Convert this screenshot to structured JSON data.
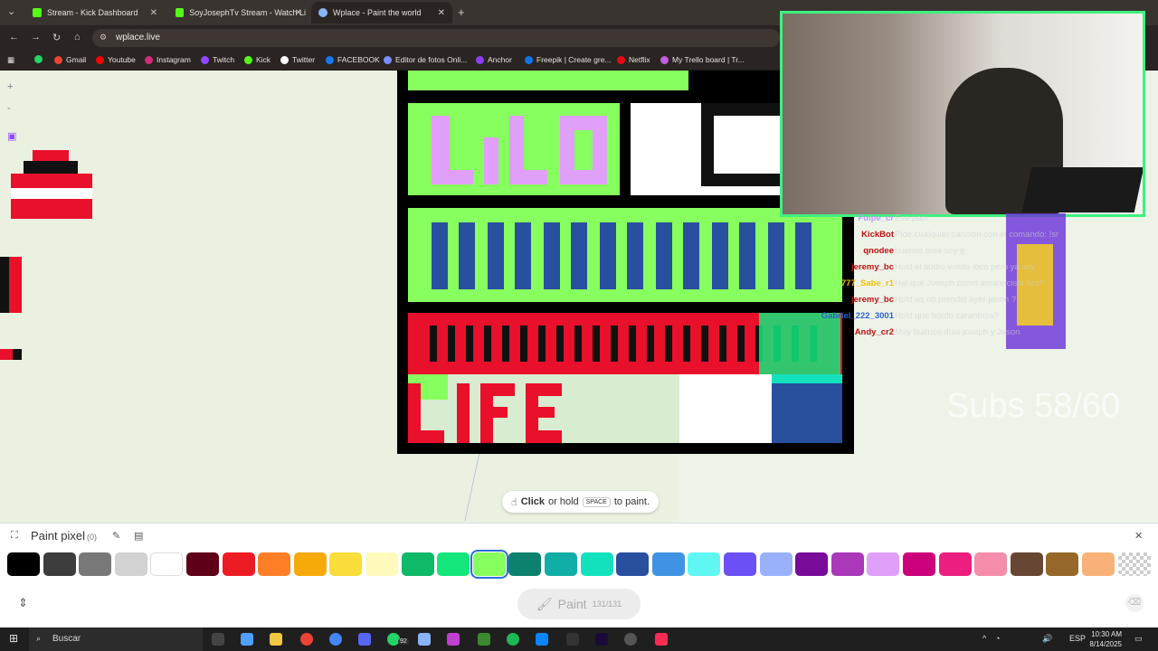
{
  "browser": {
    "tabs": [
      {
        "title": "Stream - Kick Dashboard",
        "color": "#53fc18"
      },
      {
        "title": "SoyJosephTv Stream - Watch Li",
        "color": "#53fc18"
      },
      {
        "title": "Wplace - Paint the world",
        "color": "#8ab4f8"
      }
    ],
    "add_tab": "+",
    "url": "wplace.live"
  },
  "bookmarks": [
    {
      "label": "Gmail",
      "color": "#ea4335"
    },
    {
      "label": "Youtube",
      "color": "#ff0000"
    },
    {
      "label": "Instagram",
      "color": "#d62976"
    },
    {
      "label": "Twitch",
      "color": "#9146ff"
    },
    {
      "label": "Kick",
      "color": "#53fc18"
    },
    {
      "label": "Twitter",
      "color": "#ffffff"
    },
    {
      "label": "FACEBOOK",
      "color": "#1877f2"
    },
    {
      "label": "Editor de fotos Onli...",
      "color": "#7b8cff"
    },
    {
      "label": "Anchor",
      "color": "#8940fa"
    },
    {
      "label": "Freepik | Create gre...",
      "color": "#1273eb"
    },
    {
      "label": "Netflix",
      "color": "#e50914"
    },
    {
      "label": "My Trello board | Tr...",
      "color": "#c060e0"
    }
  ],
  "map_controls": {
    "zoom_in": "+",
    "zoom_out": "-"
  },
  "chat": [
    {
      "name": "Fulpe_cr",
      "msg": "Ese papi",
      "color": "#b89cff"
    },
    {
      "name": "KickBot",
      "msg": "Pide cualquier canción con el comando: !sr",
      "color": "#c01010"
    },
    {
      "name": "qnodee",
      "msg": "buenas bola soy g",
      "color": "#c01010"
    },
    {
      "name": "jeremy_bc",
      "msg": "Hold el audio vuelto loco pero ya voy",
      "color": "#c01010"
    },
    {
      "name": "777_Sabe_r1",
      "msg": "Hal que Joseph como amaneciste bro?",
      "color": "#f2c000"
    },
    {
      "name": "jeremy_bc",
      "msg": "Hold xq no prendió ayer jason ?",
      "color": "#c01010"
    },
    {
      "name": "Gabriel_222_3001",
      "msg": "Hold que hordo caranbola?",
      "color": "#3060d0"
    },
    {
      "name": "Andy_cr2",
      "msg": "Muy buenos días joseph y Jason",
      "color": "#c01010"
    }
  ],
  "overlay": {
    "subs_text": "Subs 58/60"
  },
  "hint": {
    "action": "Click",
    "mid": "or hold",
    "key": "SPACE",
    "end": "to paint."
  },
  "panel": {
    "title": "Paint pixel",
    "count": "(0)",
    "paint_label": "Paint",
    "paint_count": "131/131"
  },
  "palette": [
    "#000000",
    "#3c3c3c",
    "#787878",
    "#d2d2d2",
    "#ffffff",
    "#600018",
    "#ed1c24",
    "#ff7f27",
    "#f6aa09",
    "#f9dd3b",
    "#fffabc",
    "#0eb968",
    "#13e67b",
    "#87ff5e",
    "#0c816e",
    "#10aea6",
    "#13e1be",
    "#28509e",
    "#4093e4",
    "#60f7f2",
    "#6b50f6",
    "#99b1fb",
    "#780c99",
    "#aa38b9",
    "#e09ff9",
    "#cb007a",
    "#ec1f80",
    "#f38da9",
    "#684634",
    "#95682a",
    "#f8b277",
    "transparent"
  ],
  "selected_color_index": 13,
  "taskbar": {
    "search_placeholder": "Buscar",
    "lang": "ESP",
    "time": "10:30 AM",
    "date": "8/14/2025",
    "whatsapp_badge": "92"
  }
}
